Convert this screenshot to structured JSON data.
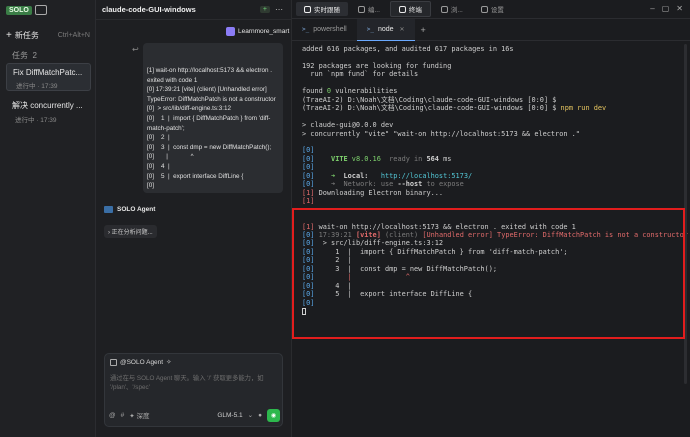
{
  "sidebar": {
    "logo": "SOLO",
    "new_task": "新任务",
    "new_task_shortcut": "Ctrl+Alt+N",
    "tasks_heading": "任务",
    "tasks_count": "2",
    "tasks": [
      {
        "title": "Fix DiffMatchPatc...",
        "status": "进行中 · 17:39"
      },
      {
        "title": "解决 concurrently ...",
        "status": "进行中 · 17:39"
      }
    ]
  },
  "chat": {
    "title": "claude-code-GUI-windows",
    "header_badge": "+",
    "user_name": "Learnmore_smart",
    "message_lines": [
      "[1] wait-on http://localhost:5173 && electron .",
      "exited with code 1",
      "[0] 17:39:21 [vite] (client) [Unhandled error]",
      "TypeError: DiffMatchPatch is not a constructor",
      "[0]  > src/lib/diff-engine.ts:3:12",
      "[0]    1  |  import { DiffMatchPatch } from 'diff-",
      "match-patch';",
      "[0]    2  |",
      "[0]    3  |  const dmp = new DiffMatchPatch();",
      "[0]       |             ^",
      "[0]    4  |",
      "[0]    5  |  export interface DiffLine {",
      "[0]"
    ],
    "agent_name": "SOLO Agent",
    "analyzing": "正在分析问题...",
    "composer_tag": "@SOLO Agent",
    "composer_placeholder": "通过在与 SOLO Agent 聊天。输入 '/' 获取更多能力，如 '/plan'、'/spec'",
    "composer_hash": "#",
    "composer_tools": "深度",
    "composer_model": "GLM-5.1"
  },
  "right": {
    "top_tabs": [
      {
        "label": "实时跟随",
        "state": "active"
      },
      {
        "label": "编...",
        "state": "normal"
      },
      {
        "label": "终端",
        "state": "selected"
      },
      {
        "label": "浏...",
        "state": "normal"
      },
      {
        "label": "设置",
        "state": "normal"
      }
    ],
    "terminal_tabs": [
      {
        "label": "powershell",
        "active": false
      },
      {
        "label": "node",
        "active": true
      }
    ]
  },
  "terminal": {
    "lines": [
      [
        {
          "t": "added 616 packages, and audited 617 packages in 16s",
          "c": ""
        }
      ],
      [
        {
          "t": "",
          "c": ""
        }
      ],
      [
        {
          "t": "192 packages are looking for funding",
          "c": ""
        }
      ],
      [
        {
          "t": "  run `npm fund` for details",
          "c": ""
        }
      ],
      [
        {
          "t": "",
          "c": ""
        }
      ],
      [
        {
          "t": "found ",
          "c": ""
        },
        {
          "t": "0",
          "c": "c-green"
        },
        {
          "t": " vulnerabilities",
          "c": ""
        }
      ],
      [
        {
          "t": "(TraeAI-2) D:\\Noah\\文档\\Coding\\claude-code-GUI-windows [0:0] $",
          "c": ""
        }
      ],
      [
        {
          "t": "(TraeAI-2) D:\\Noah\\文档\\Coding\\claude-code-GUI-windows [0:0] $ ",
          "c": ""
        },
        {
          "t": "npm run dev",
          "c": "c-yellow"
        }
      ],
      [
        {
          "t": "",
          "c": ""
        }
      ],
      [
        {
          "t": "> claude-gui@0.0.0 dev",
          "c": ""
        }
      ],
      [
        {
          "t": "> concurrently \"vite\" \"wait-on http://localhost:5173 && electron .\"",
          "c": ""
        }
      ],
      [
        {
          "t": "",
          "c": ""
        }
      ],
      [
        {
          "t": "[0]",
          "c": "c-blue"
        }
      ],
      [
        {
          "t": "[0]",
          "c": "c-blue"
        },
        {
          "t": "    VITE ",
          "c": "c-green c-bold"
        },
        {
          "t": "v8.0.16  ",
          "c": "c-green"
        },
        {
          "t": "ready in ",
          "c": "c-gray"
        },
        {
          "t": "564",
          "c": "c-bold"
        },
        {
          "t": " ms",
          "c": ""
        }
      ],
      [
        {
          "t": "[0]",
          "c": "c-blue"
        }
      ],
      [
        {
          "t": "[0]",
          "c": "c-blue"
        },
        {
          "t": "    ➜  ",
          "c": "c-green"
        },
        {
          "t": "Local:",
          "c": "c-bold"
        },
        {
          "t": "   http://localhost:5173/",
          "c": "c-cyan"
        }
      ],
      [
        {
          "t": "[0]",
          "c": "c-blue"
        },
        {
          "t": "    ➜  Network: use ",
          "c": "c-gray"
        },
        {
          "t": "--host",
          "c": "c-bold"
        },
        {
          "t": " to expose",
          "c": "c-gray"
        }
      ],
      [
        {
          "t": "[1]",
          "c": "c-red"
        },
        {
          "t": " Downloading Electron binary...",
          "c": ""
        }
      ],
      [
        {
          "t": "[1]",
          "c": "c-red"
        }
      ],
      [
        {
          "t": "",
          "c": ""
        }
      ],
      [
        {
          "t": "",
          "c": ""
        }
      ],
      [
        {
          "t": "[1]",
          "c": "c-red"
        },
        {
          "t": " wait-on http://localhost:5173 && electron . exited with code 1",
          "c": ""
        }
      ],
      [
        {
          "t": "[0]",
          "c": "c-blue"
        },
        {
          "t": " 17:39:21 ",
          "c": "c-gray"
        },
        {
          "t": "[vite]",
          "c": "c-red c-bold"
        },
        {
          "t": " (client) ",
          "c": "c-gray"
        },
        {
          "t": "[Unhandled error] ",
          "c": "c-red"
        },
        {
          "t": "TypeError: DiffMatchPatch is not a constructor",
          "c": "c-red"
        }
      ],
      [
        {
          "t": "[0]",
          "c": "c-blue"
        },
        {
          "t": "  > src/lib/diff-engine.ts:3:12",
          "c": ""
        }
      ],
      [
        {
          "t": "[0]",
          "c": "c-blue"
        },
        {
          "t": "     1  |  import { DiffMatchPatch } from 'diff-match-patch';",
          "c": ""
        }
      ],
      [
        {
          "t": "[0]",
          "c": "c-blue"
        },
        {
          "t": "     2  |",
          "c": ""
        }
      ],
      [
        {
          "t": "[0]",
          "c": "c-blue"
        },
        {
          "t": "     3  |  const dmp = new DiffMatchPatch();",
          "c": ""
        }
      ],
      [
        {
          "t": "[0]",
          "c": "c-blue"
        },
        {
          "t": "        |             ^",
          "c": "c-red"
        }
      ],
      [
        {
          "t": "[0]",
          "c": "c-blue"
        },
        {
          "t": "     4  |",
          "c": ""
        }
      ],
      [
        {
          "t": "[0]",
          "c": "c-blue"
        },
        {
          "t": "     5  |  export interface DiffLine {",
          "c": ""
        }
      ],
      [
        {
          "t": "[0]",
          "c": "c-blue"
        }
      ],
      [
        {
          "t": "",
          "c": "cursor"
        }
      ]
    ]
  },
  "colors": {
    "accent_green": "#2db84d",
    "highlight_red": "#e21d1d",
    "vite_green": "#7fd36e",
    "link_cyan": "#53c7d6"
  }
}
